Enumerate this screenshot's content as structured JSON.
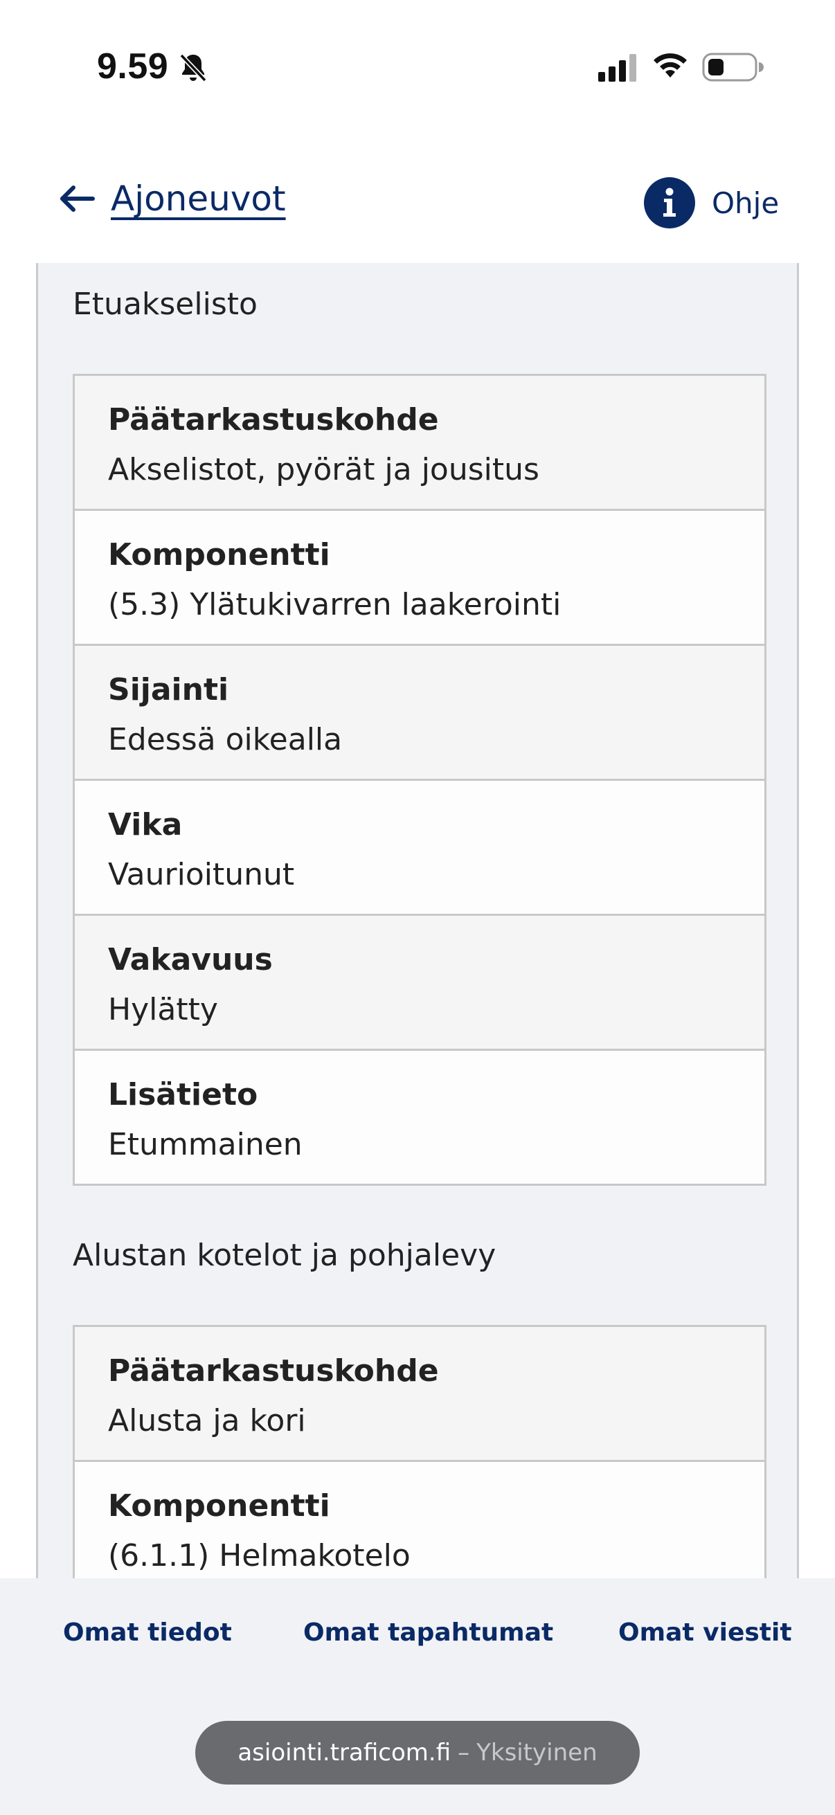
{
  "status_bar": {
    "time": "9.59",
    "icons": [
      "bell-slash-icon",
      "cellular-signal-icon",
      "wifi-icon",
      "battery-icon"
    ]
  },
  "top_nav": {
    "back_label": "Ajoneuvot",
    "back_icon": "arrow-left-icon",
    "help_label": "Ohje",
    "help_icon": "info-icon"
  },
  "colors": {
    "brand": "#0a2a66",
    "panel_bg": "#f1f2f6",
    "row_shaded": "#f5f5f5",
    "border": "#c8c8c8",
    "url_pill": "#6a6b6f"
  },
  "sections": [
    {
      "title": "Etuakselisto",
      "rows": [
        {
          "label": "Päätarkastuskohde",
          "value": "Akselistot, pyörät ja jousitus"
        },
        {
          "label": "Komponentti",
          "value": "(5.3) Ylätukivarren laakerointi"
        },
        {
          "label": "Sijainti",
          "value": "Edessä oikealla"
        },
        {
          "label": "Vika",
          "value": "Vaurioitunut"
        },
        {
          "label": "Vakavuus",
          "value": "Hylätty"
        },
        {
          "label": "Lisätieto",
          "value": "Etummainen"
        }
      ]
    },
    {
      "title": "Alustan kotelot ja pohjalevy",
      "rows": [
        {
          "label": "Päätarkastuskohde",
          "value": "Alusta ja kori"
        },
        {
          "label": "Komponentti",
          "value": "(6.1.1) Helmakotelo"
        }
      ]
    }
  ],
  "bottom_nav": {
    "items": [
      "Omat tiedot",
      "Omat tapahtumat",
      "Omat viestit"
    ]
  },
  "browser": {
    "domain": "asiointi.traficom.fi",
    "separator": "–",
    "mode": "Yksityinen"
  }
}
